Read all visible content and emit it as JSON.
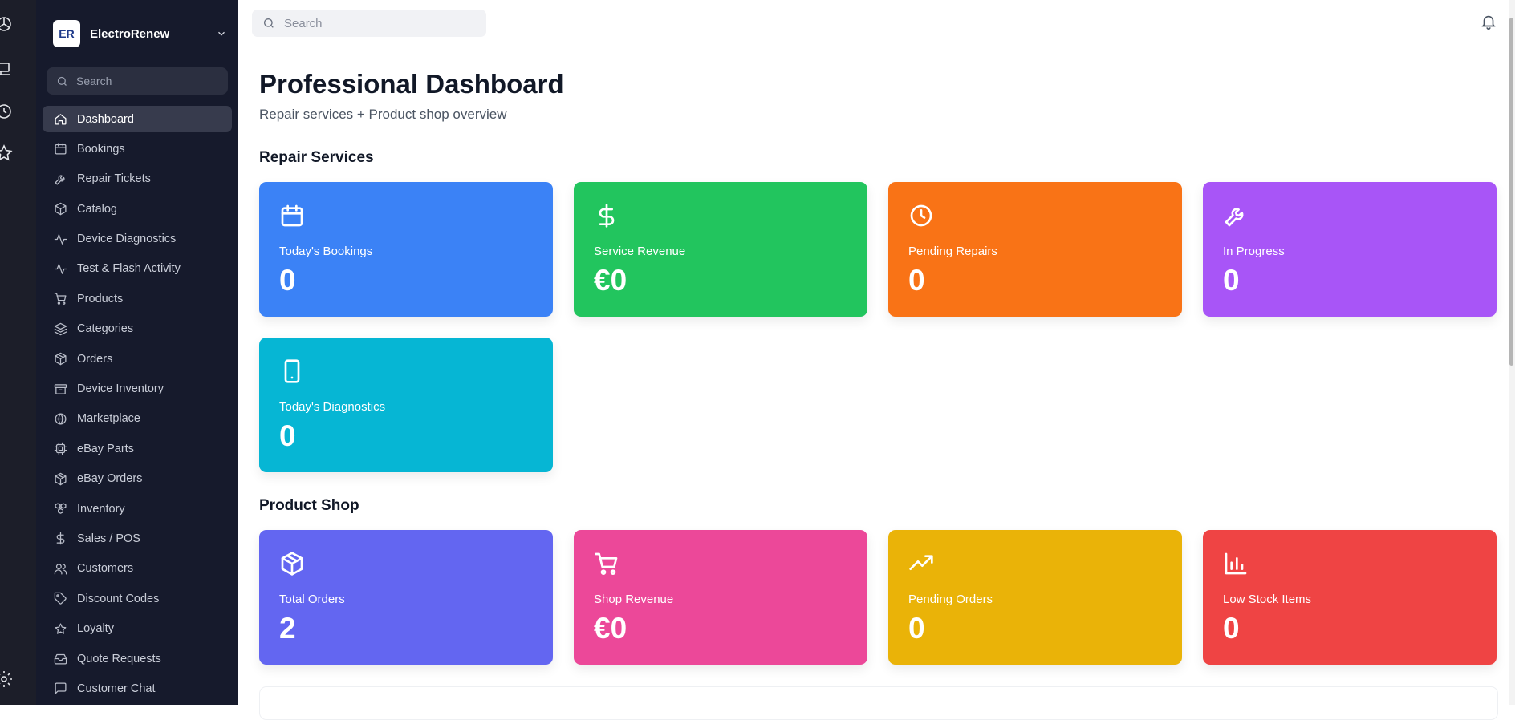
{
  "colors": {
    "sidebar_bg": "#161a2c",
    "rail_bg": "#1c1e29",
    "blue": "#3b82f6",
    "green": "#22c55e",
    "orange": "#f97316",
    "purple": "#a855f7",
    "cyan": "#06b6d4",
    "indigo": "#6366f1",
    "pink": "#ec4899",
    "yellow": "#eab308",
    "red": "#ef4444"
  },
  "sidebar": {
    "brand_name": "ElectroRenew",
    "logo_text": "ER",
    "search_placeholder": "Search",
    "items": [
      {
        "label": "Dashboard",
        "icon": "home-icon",
        "active": true
      },
      {
        "label": "Bookings",
        "icon": "calendar-icon"
      },
      {
        "label": "Repair Tickets",
        "icon": "wrench-icon"
      },
      {
        "label": "Catalog",
        "icon": "box-icon"
      },
      {
        "label": "Device Diagnostics",
        "icon": "activity-icon"
      },
      {
        "label": "Test & Flash Activity",
        "icon": "activity-icon"
      },
      {
        "label": "Products",
        "icon": "cart-icon"
      },
      {
        "label": "Categories",
        "icon": "layers-icon"
      },
      {
        "label": "Orders",
        "icon": "package-icon"
      },
      {
        "label": "Device Inventory",
        "icon": "archive-icon"
      },
      {
        "label": "Marketplace",
        "icon": "globe-icon"
      },
      {
        "label": "eBay Parts",
        "icon": "cpu-icon"
      },
      {
        "label": "eBay Orders",
        "icon": "package-icon"
      },
      {
        "label": "Inventory",
        "icon": "boxes-icon"
      },
      {
        "label": "Sales / POS",
        "icon": "dollar-icon"
      },
      {
        "label": "Customers",
        "icon": "users-icon"
      },
      {
        "label": "Discount Codes",
        "icon": "tag-icon"
      },
      {
        "label": "Loyalty",
        "icon": "star-icon"
      },
      {
        "label": "Quote Requests",
        "icon": "inbox-icon"
      },
      {
        "label": "Customer Chat",
        "icon": "chat-icon"
      }
    ]
  },
  "topbar": {
    "search_placeholder": "Search"
  },
  "main": {
    "title": "Professional Dashboard",
    "subtitle": "Repair services + Product shop overview",
    "repair_section_title": "Repair Services",
    "shop_section_title": "Product Shop",
    "repair_cards": [
      {
        "label": "Today's Bookings",
        "value": "0",
        "icon": "calendar-icon",
        "color": "#3b82f6"
      },
      {
        "label": "Service Revenue",
        "value": "€0",
        "icon": "dollar-icon",
        "color": "#22c55e"
      },
      {
        "label": "Pending Repairs",
        "value": "0",
        "icon": "clock-icon",
        "color": "#f97316"
      },
      {
        "label": "In Progress",
        "value": "0",
        "icon": "wrench-icon",
        "color": "#a855f7"
      },
      {
        "label": "Today's Diagnostics",
        "value": "0",
        "icon": "phone-icon",
        "color": "#06b6d4"
      }
    ],
    "shop_cards": [
      {
        "label": "Total Orders",
        "value": "2",
        "icon": "package-icon",
        "color": "#6366f1"
      },
      {
        "label": "Shop Revenue",
        "value": "€0",
        "icon": "cart-icon",
        "color": "#ec4899"
      },
      {
        "label": "Pending Orders",
        "value": "0",
        "icon": "trending-up-icon",
        "color": "#eab308"
      },
      {
        "label": "Low Stock Items",
        "value": "0",
        "icon": "bar-chart-icon",
        "color": "#ef4444"
      }
    ]
  }
}
